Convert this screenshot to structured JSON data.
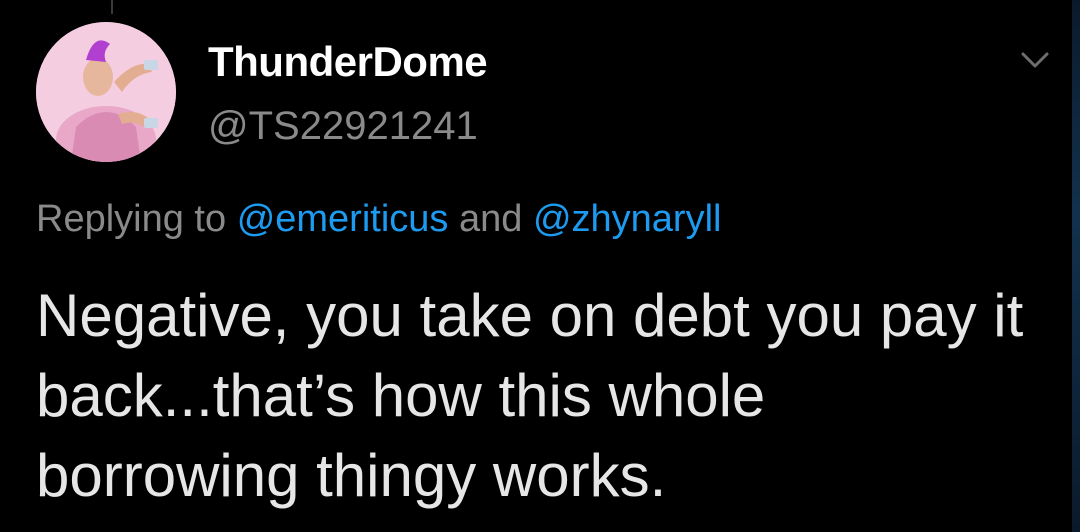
{
  "tweet": {
    "display_name": "ThunderDome",
    "handle": "@TS22921241",
    "replying_prefix": "Replying to",
    "reply_mentions": [
      "@emeriticus",
      "@zhynaryll"
    ],
    "reply_conjunction": "and",
    "text": "Negative, you take on debt you pay it back...that’s how this whole borrowing thingy works."
  },
  "icons": {
    "menu": "chevron-down-icon",
    "avatar": "avatar"
  },
  "colors": {
    "background": "#000000",
    "name": "#ffffff",
    "secondary": "#8a8a8a",
    "mention": "#1d9bf0",
    "body": "#e6e6e6"
  }
}
